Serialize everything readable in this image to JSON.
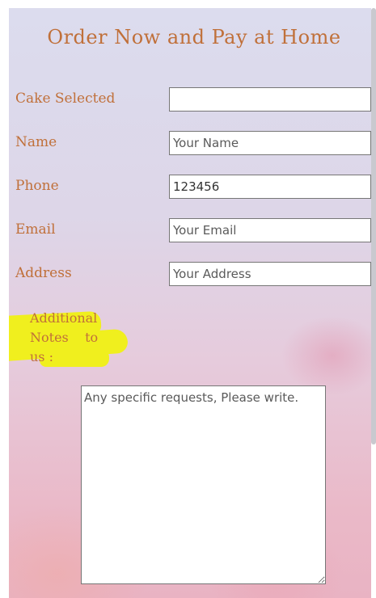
{
  "form": {
    "title": "Order Now and Pay at Home",
    "fields": [
      {
        "label": "Cake Selected",
        "value": "",
        "placeholder": ""
      },
      {
        "label": "Name",
        "value": "",
        "placeholder": "Your Name"
      },
      {
        "label": "Phone",
        "value": "123456",
        "placeholder": ""
      },
      {
        "label": "Email",
        "value": "",
        "placeholder": "Your Email"
      },
      {
        "label": "Address",
        "value": "",
        "placeholder": "Your Address"
      }
    ],
    "notes": {
      "label_lines": [
        "Additional",
        "Notes    to",
        "us :"
      ],
      "placeholder": "Any specific requests, Please write.",
      "value": ""
    }
  },
  "colors": {
    "label": "#c0703a",
    "highlight": "#f0ef1e"
  }
}
